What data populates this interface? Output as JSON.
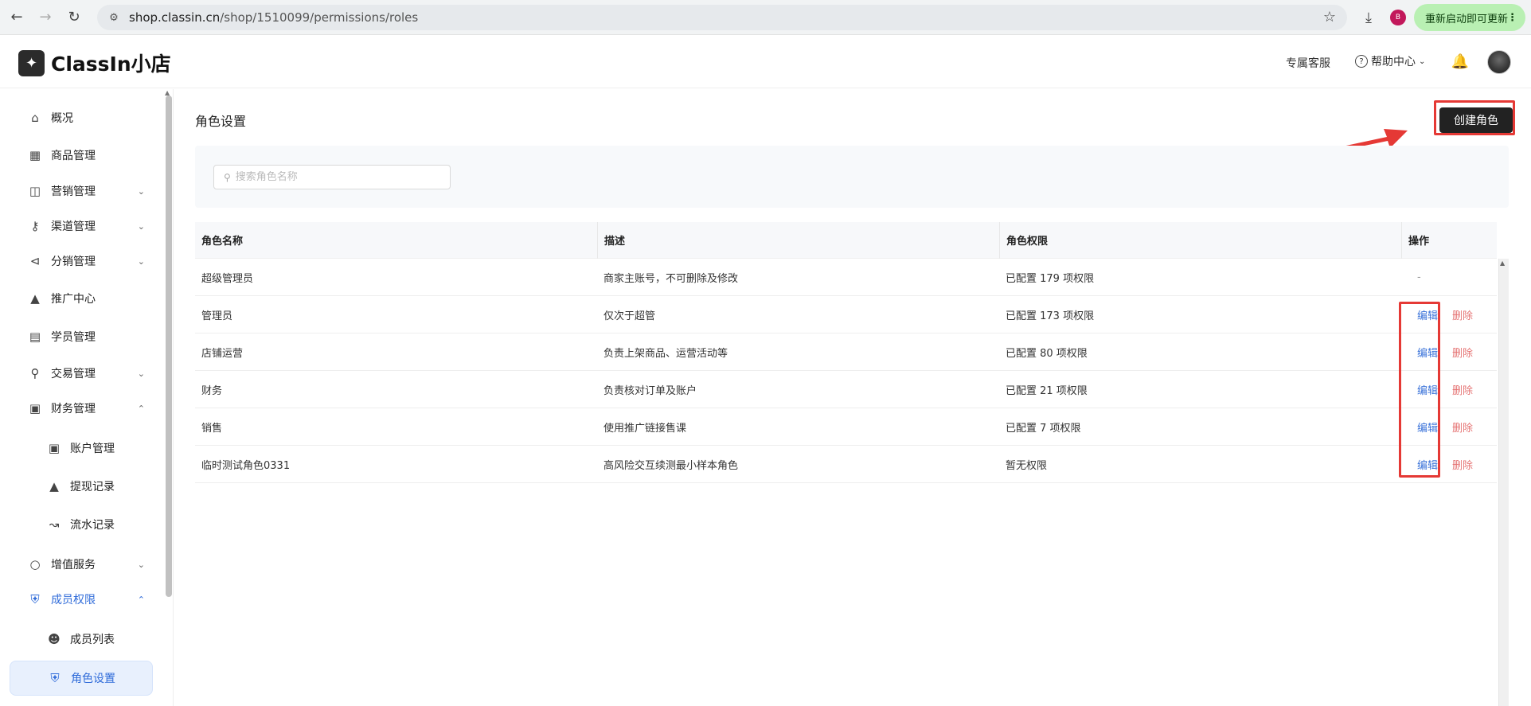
{
  "browser": {
    "url_host": "shop.classin.cn",
    "url_path": "/shop/1510099/permissions/roles",
    "profile_initial": "B",
    "update_label": "重新启动即可更新"
  },
  "header": {
    "brand": "ClassIn小店",
    "support_link": "专属客服",
    "help_link": "帮助中心"
  },
  "sidebar": {
    "items": [
      {
        "label": "概况",
        "icon": "home-icon"
      },
      {
        "label": "商品管理",
        "icon": "grid-icon"
      },
      {
        "label": "营销管理",
        "icon": "gift-icon"
      },
      {
        "label": "渠道管理",
        "icon": "channel-icon"
      },
      {
        "label": "分销管理",
        "icon": "share-icon"
      },
      {
        "label": "推广中心",
        "icon": "rocket-icon"
      },
      {
        "label": "学员管理",
        "icon": "student-icon"
      },
      {
        "label": "交易管理",
        "icon": "cart-icon"
      },
      {
        "label": "财务管理",
        "icon": "wallet-icon"
      },
      {
        "label": "账户管理",
        "icon": "account-icon"
      },
      {
        "label": "提现记录",
        "icon": "withdraw-icon"
      },
      {
        "label": "流水记录",
        "icon": "chart-line-icon"
      },
      {
        "label": "增值服务",
        "icon": "chat-icon"
      },
      {
        "label": "成员权限",
        "icon": "shield-icon"
      },
      {
        "label": "成员列表",
        "icon": "users-icon"
      },
      {
        "label": "角色设置",
        "icon": "shield-check-icon"
      }
    ]
  },
  "main": {
    "title": "角色设置",
    "create_button": "创建角色",
    "search_placeholder": "搜索角色名称",
    "columns": [
      "角色名称",
      "描述",
      "角色权限",
      "操作"
    ],
    "rows": [
      {
        "name": "超级管理员",
        "desc": "商家主账号，不可删除及修改",
        "perm": "已配置 179 项权限",
        "ops": "-"
      },
      {
        "name": "管理员",
        "desc": "仅次于超管",
        "perm": "已配置 173 项权限"
      },
      {
        "name": "店铺运营",
        "desc": "负责上架商品、运营活动等",
        "perm": "已配置 80 项权限"
      },
      {
        "name": "财务",
        "desc": "负责核对订单及账户",
        "perm": "已配置 21 项权限"
      },
      {
        "name": "销售",
        "desc": "使用推广链接售课",
        "perm": "已配置 7 项权限"
      },
      {
        "name": "临时测试角色0331",
        "desc": "高风险交互续测最小样本角色",
        "perm": "暂无权限"
      }
    ],
    "edit_label": "编辑",
    "delete_label": "删除"
  },
  "colors": {
    "accent": "#2f6bd9",
    "danger": "#e57373",
    "annotation": "#e53935"
  }
}
